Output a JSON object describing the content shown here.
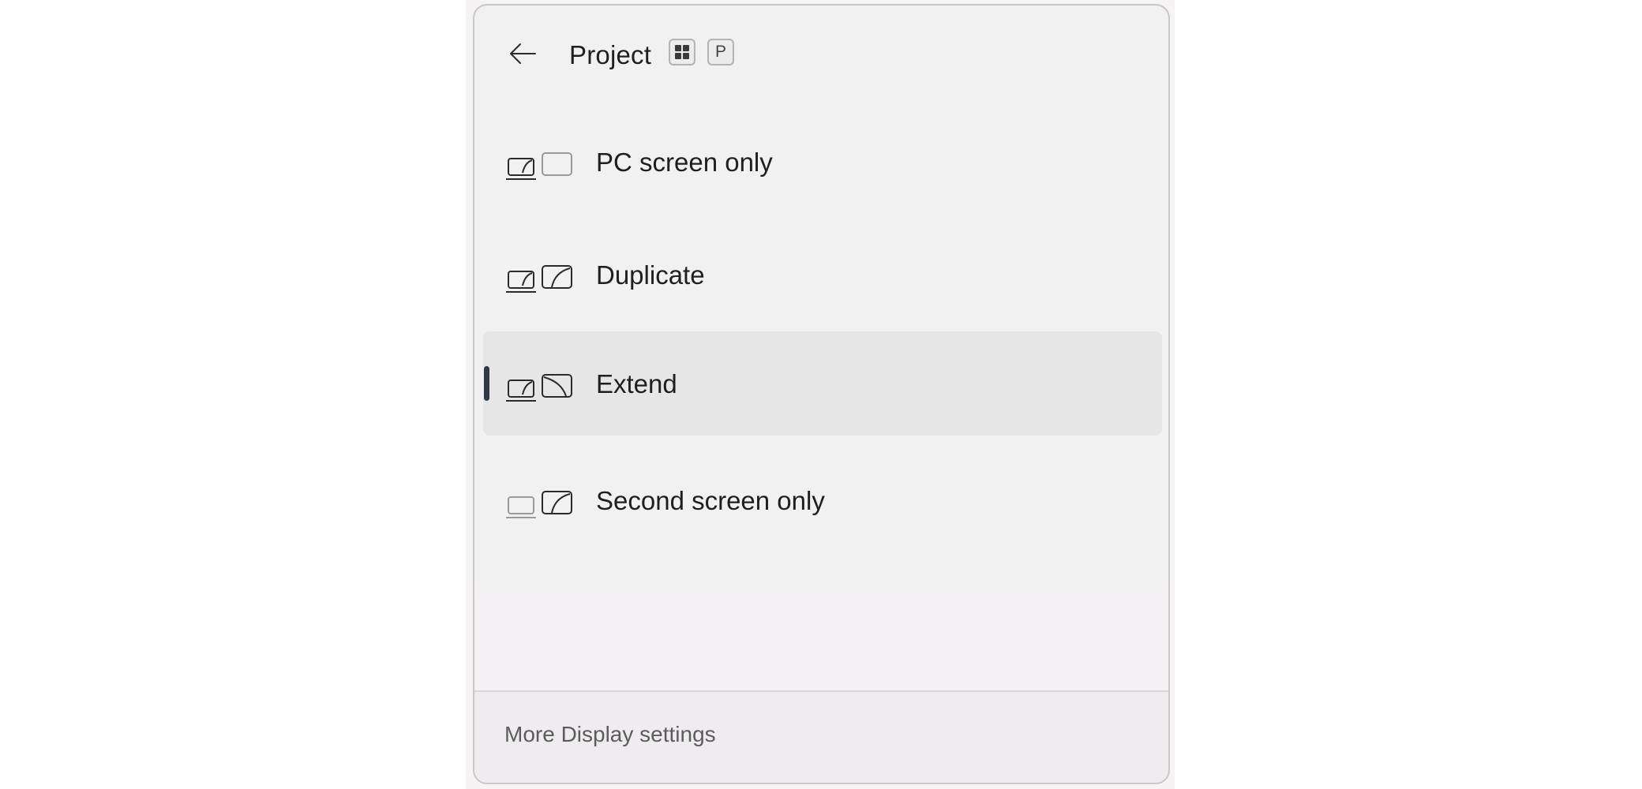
{
  "header": {
    "back_icon": "arrow-left-icon",
    "title": "Project",
    "shortcut_keys": [
      {
        "type": "icon",
        "icon": "windows-logo-icon"
      },
      {
        "type": "text",
        "label": "P"
      }
    ]
  },
  "options": [
    {
      "id": "pc-screen-only",
      "label": "PC screen only",
      "icon": "pc-screen-only-icon",
      "selected": false
    },
    {
      "id": "duplicate",
      "label": "Duplicate",
      "icon": "duplicate-icon",
      "selected": false
    },
    {
      "id": "extend",
      "label": "Extend",
      "icon": "extend-icon",
      "selected": true
    },
    {
      "id": "second-screen-only",
      "label": "Second screen only",
      "icon": "second-screen-only-icon",
      "selected": false
    }
  ],
  "footer": {
    "link_label": "More Display settings"
  },
  "colors": {
    "panel_background": "#f1f1f1",
    "selected_background": "#e6e6e6",
    "selection_indicator": "#2e3a45",
    "text_primary": "#1f1f1f",
    "text_secondary": "#5c5c5c"
  }
}
